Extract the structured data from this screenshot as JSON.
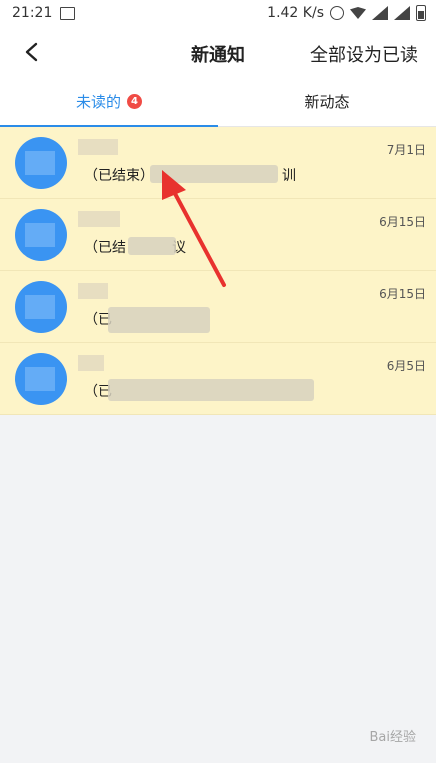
{
  "status_bar": {
    "time": "21:21",
    "network_speed": "1.42 K/s",
    "icons": [
      "gallery-icon",
      "alarm-icon",
      "wifi-icon",
      "signal-icon",
      "signal-icon",
      "battery-icon"
    ]
  },
  "header": {
    "back_icon": "back-arrow-icon",
    "title": "新通知",
    "mark_all_read": "全部设为已读"
  },
  "tabs": [
    {
      "label": "未读的",
      "badge": "4",
      "active": true
    },
    {
      "label": "新动态",
      "active": false
    }
  ],
  "notifications": [
    {
      "date": "7月1日",
      "desc_prefix": "（已结束）",
      "desc_suffix": "训"
    },
    {
      "date": "6月15日",
      "desc_prefix": "（已结",
      "desc_suffix": "议"
    },
    {
      "date": "6月15日",
      "desc_prefix": "（已",
      "desc_suffix": ""
    },
    {
      "date": "6月5日",
      "desc_prefix": "（已",
      "desc_suffix": ""
    }
  ],
  "colors": {
    "accent": "#2b8ce8",
    "badge": "#f04b45",
    "unread_row_bg": "#fdf4c8",
    "avatar": "#3a94f2",
    "annotation_arrow": "#e8322e"
  },
  "watermark": "Bai经验"
}
